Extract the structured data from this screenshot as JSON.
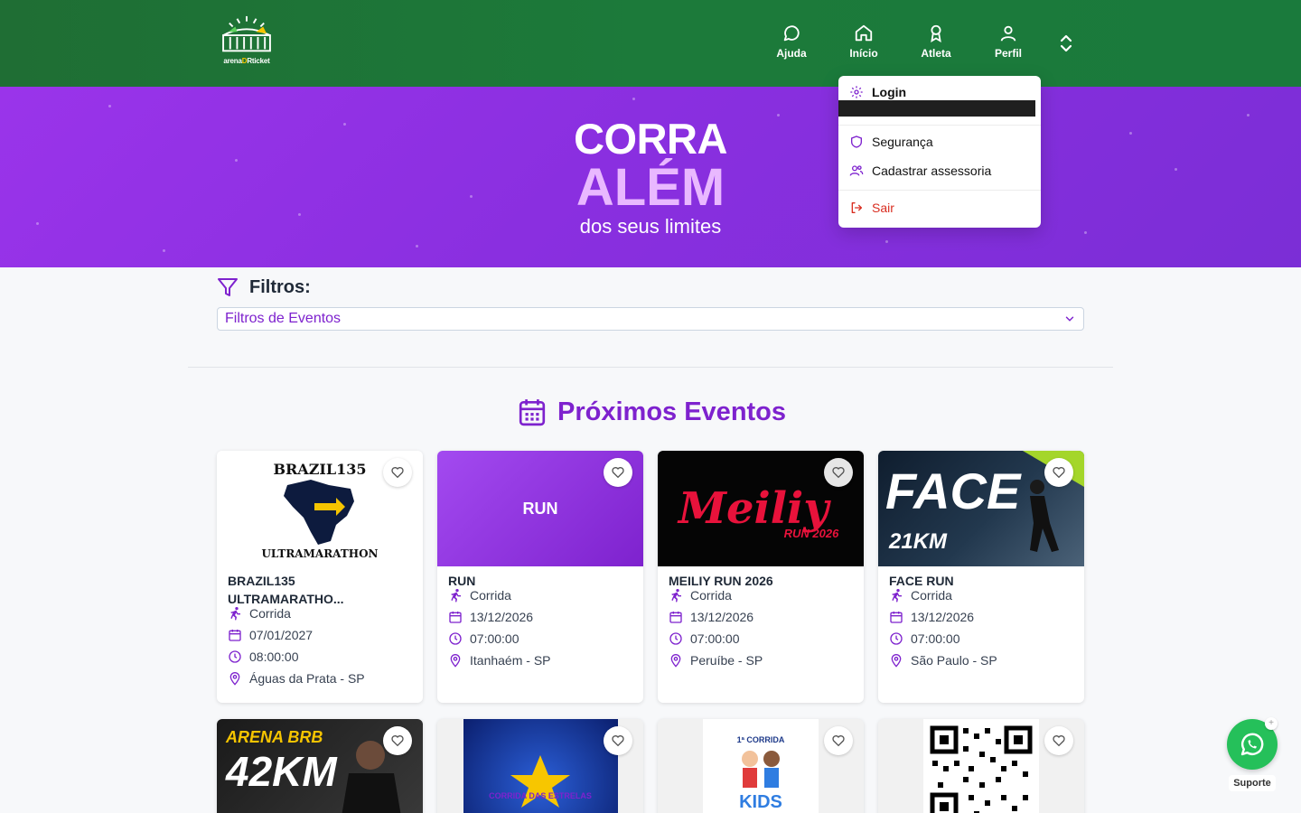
{
  "header": {
    "logo": {
      "text_left": "arena",
      "text_mid": "D",
      "text_right": "Rticket"
    },
    "nav": [
      {
        "label": "Ajuda",
        "icon": "chat-bubble-icon"
      },
      {
        "label": "Início",
        "icon": "home-icon"
      },
      {
        "label": "Atleta",
        "icon": "medal-icon"
      },
      {
        "label": "Perfil",
        "icon": "user-icon"
      }
    ],
    "toggle_icon": "chevron-up-down-icon"
  },
  "hero": {
    "line1": "CORRA",
    "line2": "ALÉM",
    "line3": "dos seus limites"
  },
  "profile_menu": {
    "items": [
      {
        "label": "Login",
        "icon": "gear-icon"
      },
      {
        "label": "Segurança",
        "icon": "shield-icon"
      },
      {
        "label": "Cadastrar assessoria",
        "icon": "users-icon"
      },
      {
        "label": "Sair",
        "icon": "logout-icon"
      }
    ]
  },
  "filters": {
    "title": "Filtros:",
    "select_label": "Filtros de Eventos"
  },
  "events_section": {
    "title": "Próximos Eventos"
  },
  "events": [
    {
      "title": "BRAZIL135 ULTRAMARATHO...",
      "type": "Corrida",
      "date": "07/01/2027",
      "time": "08:00:00",
      "location": "Águas da Prata - SP",
      "image_text": "BRAZIL135",
      "image_sub": "ULTRAMARATHON"
    },
    {
      "title": "RUN",
      "type": "Corrida",
      "date": "13/12/2026",
      "time": "07:00:00",
      "location": "Itanhaém - SP",
      "image_text": "RUN"
    },
    {
      "title": "MEILIY RUN 2026",
      "type": "Corrida",
      "date": "13/12/2026",
      "time": "07:00:00",
      "location": "Peruíbe - SP",
      "image_text": "Meiliy",
      "image_sub": "RUN 2026"
    },
    {
      "title": "FACE RUN",
      "type": "Corrida",
      "date": "13/12/2026",
      "time": "07:00:00",
      "location": "São Paulo - SP",
      "image_text": "FACE",
      "image_sub": "21KM"
    }
  ],
  "events_row2": [
    {
      "image_text": "42KM",
      "image_sub": "ARENA BRB"
    },
    {
      "image_text": "CORRIDA DAS ESTRELAS"
    },
    {
      "image_text": "KIDS",
      "image_sub": "1ª CORRIDA"
    },
    {
      "image_text": "QR"
    }
  ],
  "support": {
    "label": "Suporte",
    "close": "+"
  },
  "colors": {
    "header_green": "#1c7a3a",
    "purple": "#7e22ce",
    "hero_purple": "#8a2fe0"
  }
}
